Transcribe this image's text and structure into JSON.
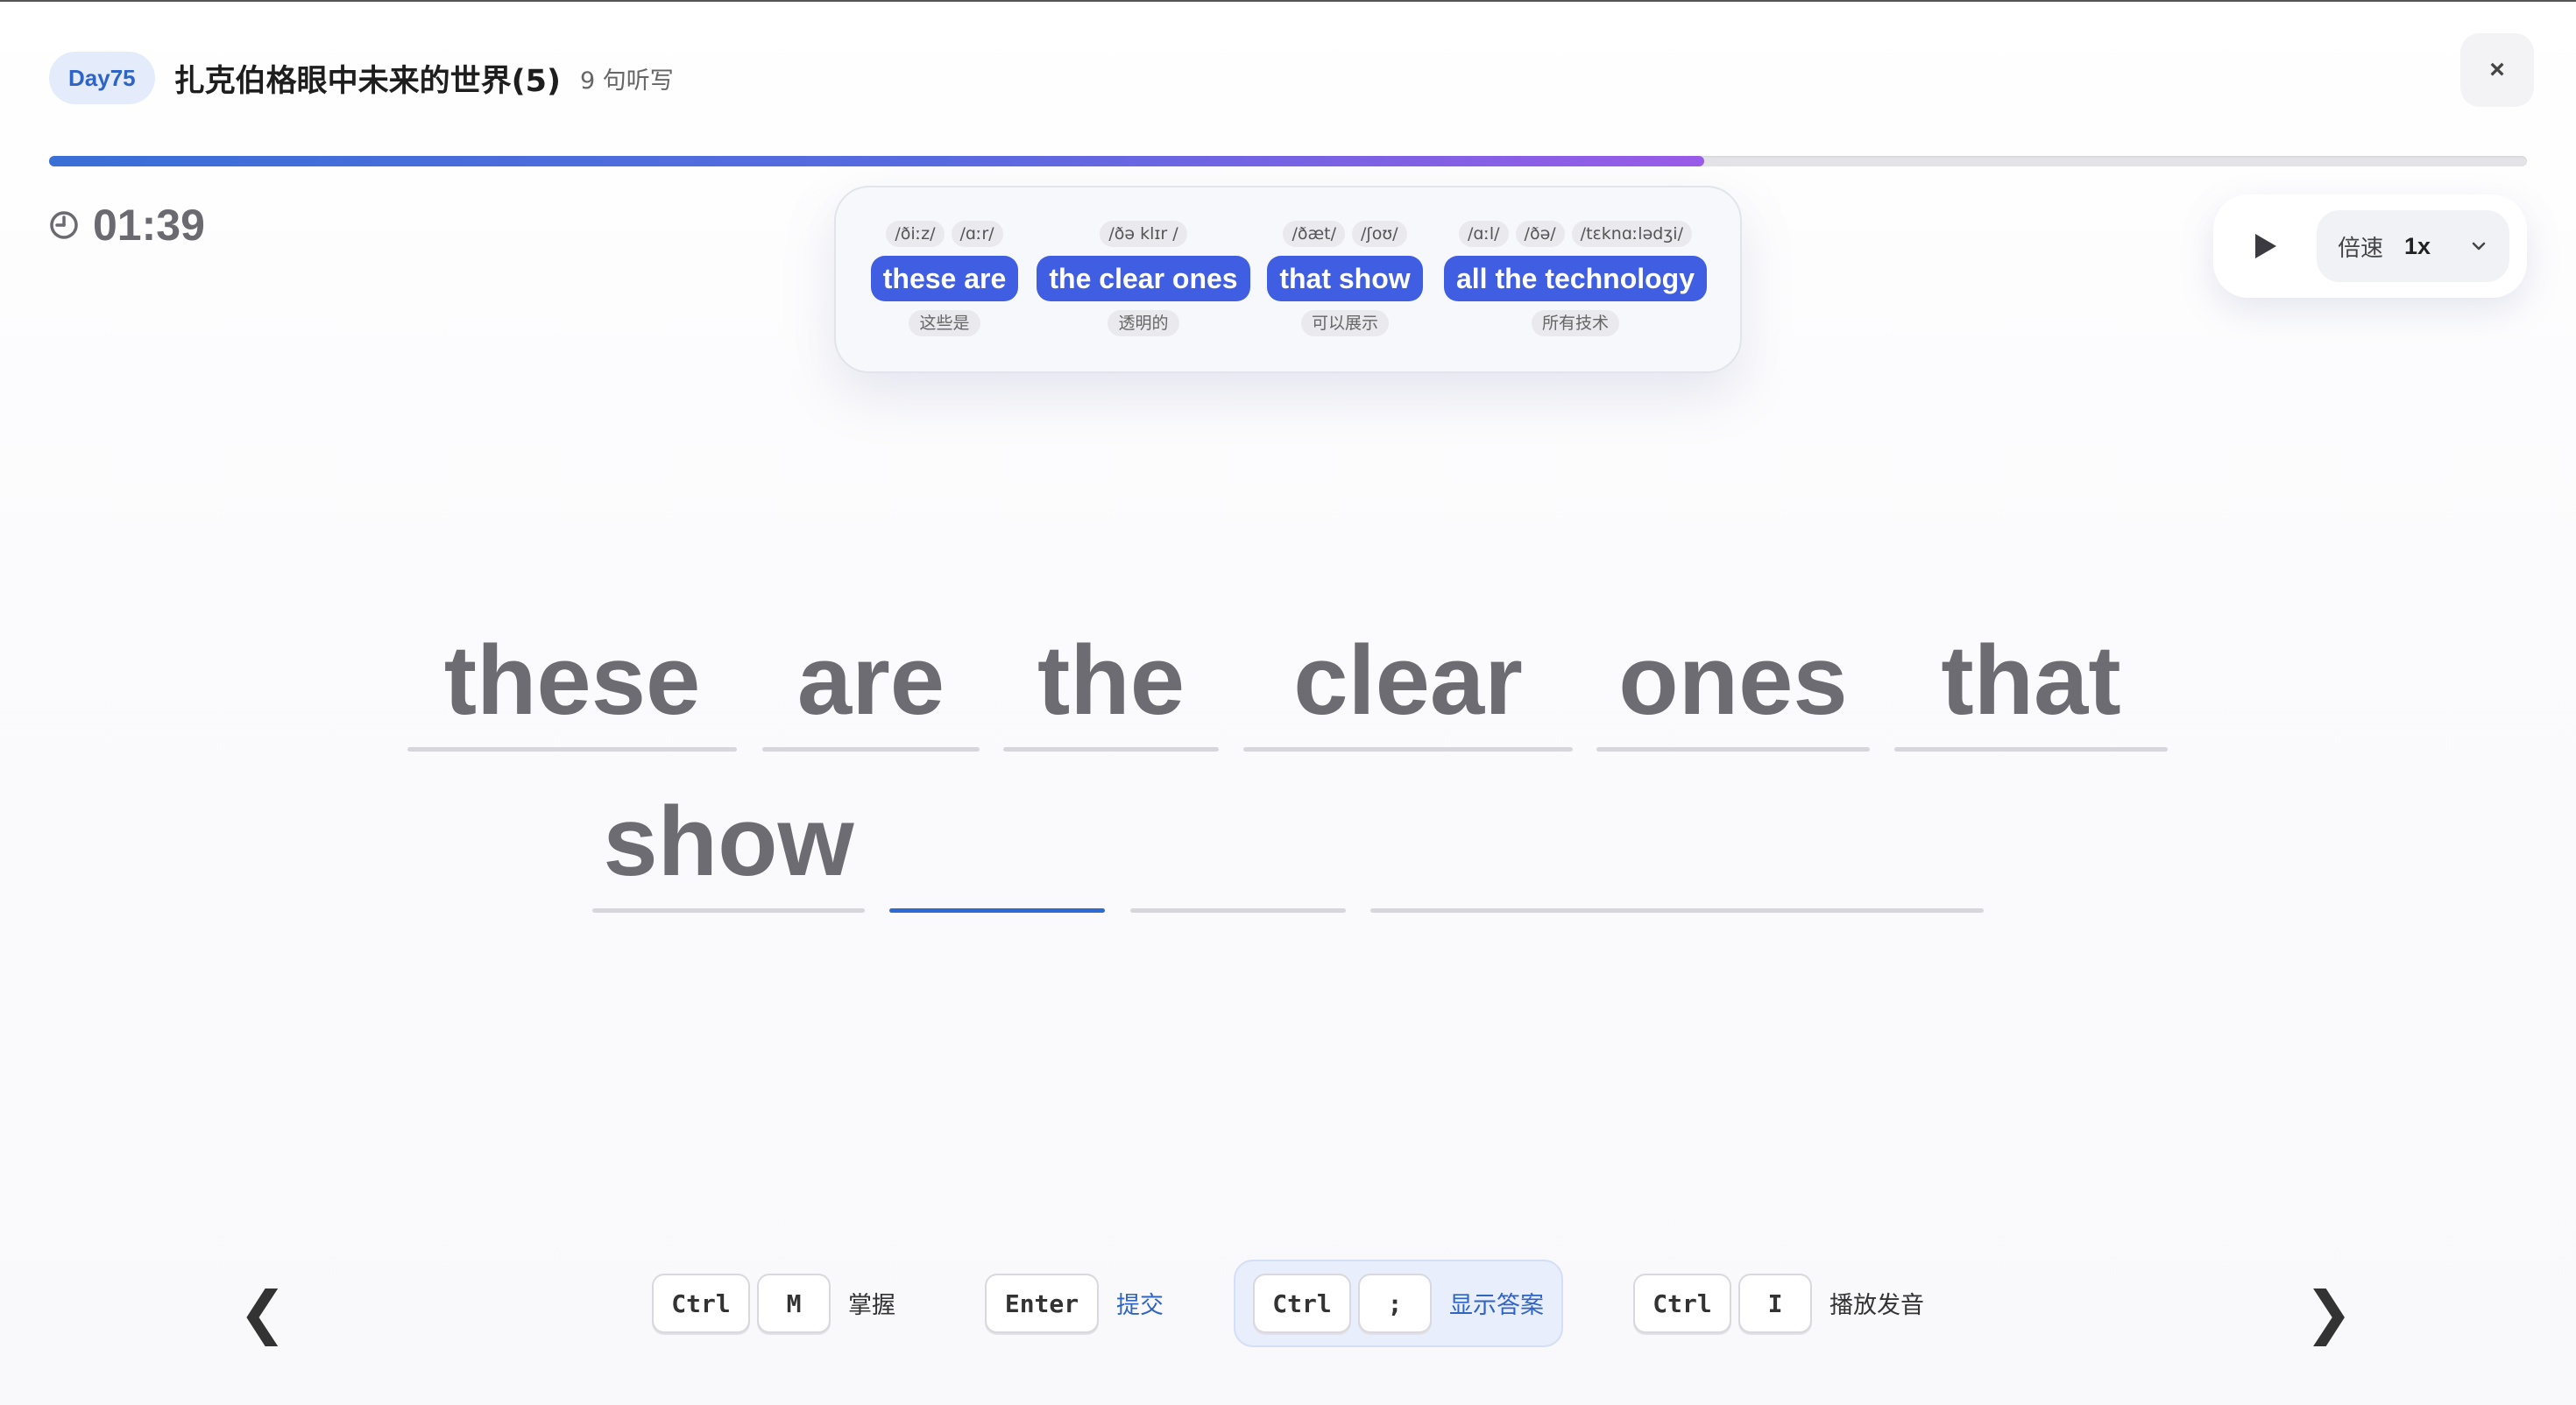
{
  "header": {
    "day_badge": "Day75",
    "lesson_title": "扎克伯格眼中未来的世界(5)",
    "sentence_count": "9 句听写",
    "close_label": "×"
  },
  "progress": {
    "fraction": 0.668
  },
  "timer": {
    "value": "01:39"
  },
  "phrases": [
    {
      "ipa": [
        "/ðiːz/",
        "/ɑːr/"
      ],
      "text": "these are",
      "translation": "这些是"
    },
    {
      "ipa": [
        "/ðə klɪr /"
      ],
      "text": "the clear ones",
      "translation": "透明的"
    },
    {
      "ipa": [
        "/ðæt/",
        "/ʃoʊ/"
      ],
      "text": "that show",
      "translation": "可以展示"
    },
    {
      "ipa": [
        "/ɑːl/",
        "/ðə/",
        "/tɛknɑːlədʒi/"
      ],
      "text": "all the technology",
      "translation": "所有技术"
    }
  ],
  "player": {
    "speed_label": "倍速",
    "speed_value": "1x"
  },
  "dictation": {
    "words": [
      "these",
      "are",
      "the",
      "clear",
      "ones",
      "that",
      "show",
      "",
      "",
      ""
    ],
    "active_index": 7
  },
  "shortcuts": {
    "prev_arrow": "❮",
    "next_arrow": "❯",
    "master": {
      "keys": [
        "Ctrl",
        "M"
      ],
      "label": "掌握"
    },
    "submit": {
      "keys": [
        "Enter"
      ],
      "label": "提交"
    },
    "show_answer": {
      "keys": [
        "Ctrl",
        ";"
      ],
      "label": "显示答案"
    },
    "play_audio": {
      "keys": [
        "Ctrl",
        "I"
      ],
      "label": "播放发音"
    }
  },
  "colors": {
    "accent": "#3f5ee2",
    "badge_text": "#2e64c6",
    "progress_start": "#3a6fd6",
    "progress_end": "#9a5ce8"
  },
  "icons": {
    "timer": "clock-icon",
    "play": "play-icon",
    "speed_dropdown": "chevron-down-icon",
    "close": "close-icon"
  }
}
